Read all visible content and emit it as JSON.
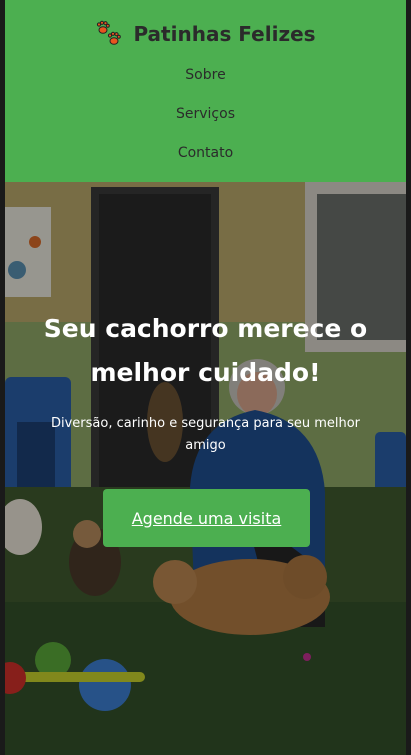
{
  "header": {
    "brand_title": "Patinhas Felizes",
    "brand_icon": "paw-prints-icon",
    "nav": [
      "Sobre",
      "Serviços",
      "Contato"
    ]
  },
  "hero": {
    "headline_line1": "Seu cachorro merece o",
    "headline_line2": "melhor cuidado!",
    "subtitle_line1": "Diversão, carinho e segurança para seu melhor",
    "subtitle_line2": "amigo",
    "cta_label": "Agende uma visita",
    "background_image": "dog-daycare-photo"
  },
  "colors": {
    "accent": "#4caf50",
    "text_dark": "#2b2b2b",
    "hero_text": "#ffffff"
  }
}
